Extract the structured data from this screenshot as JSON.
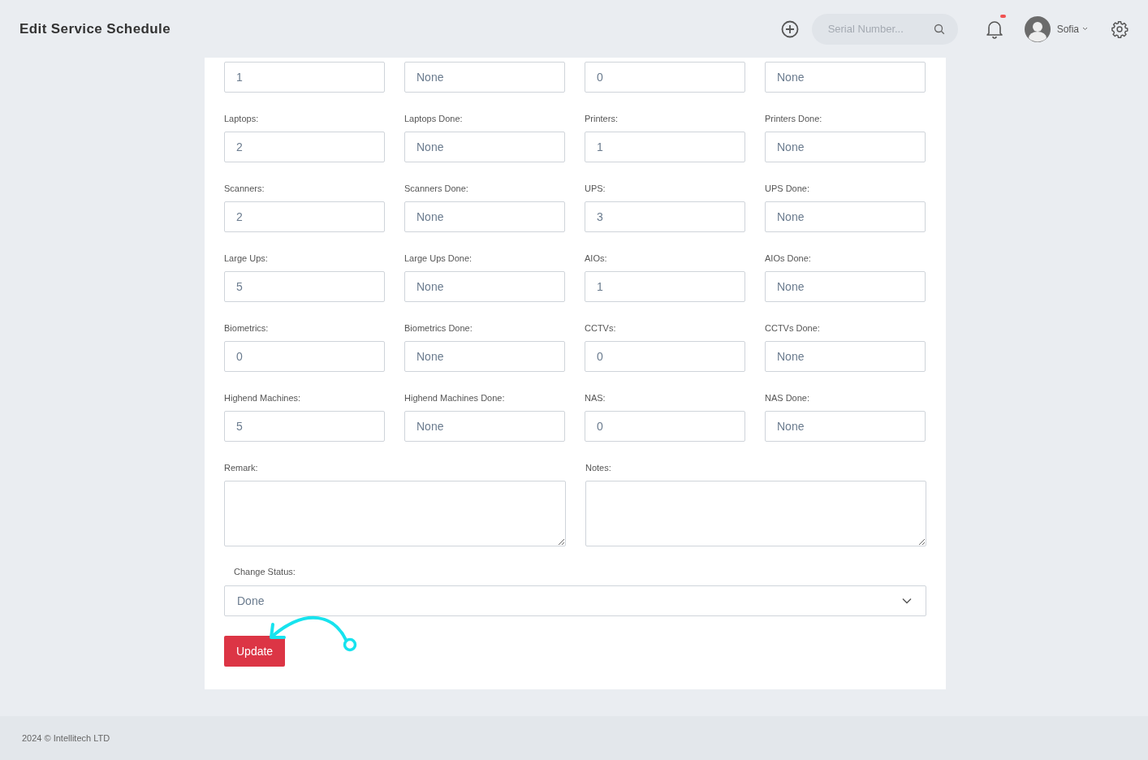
{
  "header": {
    "title": "Edit Service Schedule",
    "search": {
      "placeholder": "Serial Number..."
    },
    "notification_unread": true,
    "user": {
      "name": "Sofia"
    }
  },
  "field_rows": [
    [
      {
        "value": "1"
      },
      {
        "value": "None"
      },
      {
        "value": "0"
      },
      {
        "value": "None"
      }
    ],
    [
      {
        "label": "Laptops:",
        "value": "2"
      },
      {
        "label": "Laptops Done:",
        "value": "None"
      },
      {
        "label": "Printers:",
        "value": "1"
      },
      {
        "label": "Printers Done:",
        "value": "None"
      }
    ],
    [
      {
        "label": "Scanners:",
        "value": "2"
      },
      {
        "label": "Scanners Done:",
        "value": "None"
      },
      {
        "label": "UPS:",
        "value": "3"
      },
      {
        "label": "UPS Done:",
        "value": "None"
      }
    ],
    [
      {
        "label": "Large Ups:",
        "value": "5"
      },
      {
        "label": "Large Ups Done:",
        "value": "None"
      },
      {
        "label": "AIOs:",
        "value": "1"
      },
      {
        "label": "AIOs Done:",
        "value": "None"
      }
    ],
    [
      {
        "label": "Biometrics:",
        "value": "0"
      },
      {
        "label": "Biometrics Done:",
        "value": "None"
      },
      {
        "label": "CCTVs:",
        "value": "0"
      },
      {
        "label": "CCTVs Done:",
        "value": "None"
      }
    ],
    [
      {
        "label": "Highend Machines:",
        "value": "5"
      },
      {
        "label": "Highend Machines Done:",
        "value": "None"
      },
      {
        "label": "NAS:",
        "value": "0"
      },
      {
        "label": "NAS Done:",
        "value": "None"
      }
    ]
  ],
  "text_areas": [
    {
      "label": "Remark:"
    },
    {
      "label": "Notes:"
    }
  ],
  "status": {
    "label": "Change Status:",
    "value": "Done"
  },
  "update_button": "Update",
  "footer": "2024 © Intellitech LTD"
}
